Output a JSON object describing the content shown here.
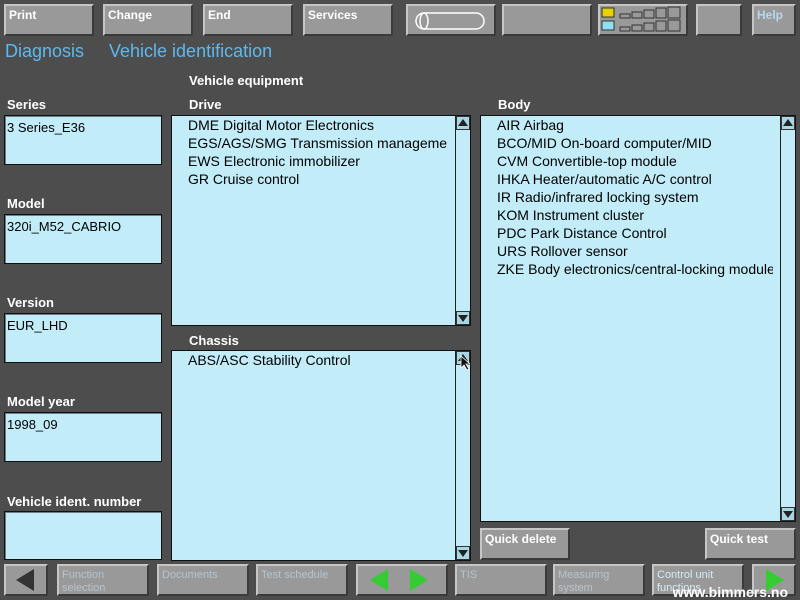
{
  "toolbar": {
    "print": "Print",
    "change": "Change",
    "end": "End",
    "services": "Services",
    "help": "Help"
  },
  "title": {
    "diagnosis": "Diagnosis",
    "vehicle_identification": "Vehicle identification"
  },
  "vehicle_equipment_label": "Vehicle equipment",
  "left_fields": {
    "series_label": "Series",
    "series_value": "3 Series_E36",
    "model_label": "Model",
    "model_value": "320i_M52_CABRIO",
    "version_label": "Version",
    "version_value": "EUR_LHD",
    "model_year_label": "Model year",
    "model_year_value": "1998_09",
    "vin_label": "Vehicle ident. number",
    "vin_value": ""
  },
  "drive": {
    "label": "Drive",
    "items": [
      "DME Digital Motor Electronics",
      "EGS/AGS/SMG Transmission management",
      "EWS Electronic immobilizer",
      "GR Cruise control"
    ]
  },
  "chassis": {
    "label": "Chassis",
    "items": [
      "ABS/ASC Stability Control"
    ]
  },
  "body": {
    "label": "Body",
    "items": [
      "AIR Airbag",
      "BCO/MID On-board computer/MID",
      "CVM Convertible-top module",
      "IHKA Heater/automatic A/C control",
      "IR Radio/infrared locking system",
      "KOM Instrument cluster",
      "PDC Park Distance Control",
      "URS Rollover sensor",
      "ZKE Body electronics/central-locking module"
    ]
  },
  "actions": {
    "quick_delete": "Quick delete",
    "quick_test": "Quick test"
  },
  "bottom_nav": {
    "function_selection": "Function selection",
    "documents": "Documents",
    "test_schedule": "Test schedule",
    "tis": "TIS",
    "measuring_system": "Measuring system",
    "control_unit_functions": "Control unit functions"
  },
  "watermark": "www.bimmers.no",
  "colors": {
    "background": "#4d4d4d",
    "button": "#999999",
    "field": "#c2ecf8",
    "heading": "#5db9f0",
    "arrow_green": "#33cc33"
  }
}
